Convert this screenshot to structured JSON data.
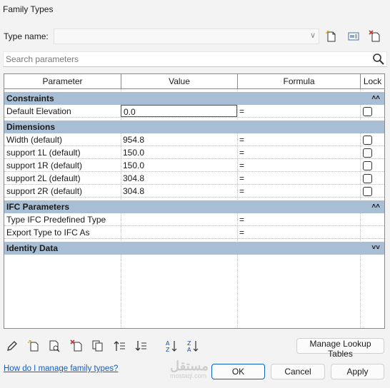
{
  "window": {
    "title": "Family Types"
  },
  "type_name": {
    "label": "Type name:",
    "value": ""
  },
  "search": {
    "placeholder": "Search parameters"
  },
  "columns": {
    "parameter": "Parameter",
    "value": "Value",
    "formula": "Formula",
    "lock": "Lock"
  },
  "groups": {
    "constraints": {
      "label": "Constraints",
      "rows": [
        {
          "parameter": "Default Elevation",
          "value": "0.0",
          "formula": "=",
          "locked": false
        }
      ]
    },
    "dimensions": {
      "label": "Dimensions",
      "rows": [
        {
          "parameter": "Width (default)",
          "value": "954.8",
          "formula": "=",
          "locked": false
        },
        {
          "parameter": "support 1L (default)",
          "value": "150.0",
          "formula": "=",
          "locked": false
        },
        {
          "parameter": "support 1R (default)",
          "value": "150.0",
          "formula": "=",
          "locked": false
        },
        {
          "parameter": "support 2L (default)",
          "value": "304.8",
          "formula": "=",
          "locked": false
        },
        {
          "parameter": "support 2R (default)",
          "value": "304.8",
          "formula": "=",
          "locked": false
        }
      ]
    },
    "ifc": {
      "label": "IFC Parameters",
      "rows": [
        {
          "parameter": "Type IFC Predefined Type",
          "value": "",
          "formula": "="
        },
        {
          "parameter": "Export Type to IFC As",
          "value": "",
          "formula": "="
        }
      ]
    },
    "identity": {
      "label": "Identity Data"
    }
  },
  "icons": {
    "toolbar": [
      "new-type-icon",
      "rename-type-icon",
      "delete-type-icon"
    ],
    "bottom": [
      "edit-parameter-icon",
      "new-parameter-icon",
      "shared-parameter-icon",
      "delete-parameter-icon",
      "copy-parameter-icon",
      "move-up-icon",
      "move-down-icon",
      "sort-ascending-icon",
      "sort-descending-icon"
    ]
  },
  "buttons": {
    "manage_lookup": "Manage Lookup Tables",
    "ok": "OK",
    "cancel": "Cancel",
    "apply": "Apply"
  },
  "help_link": "How do I manage family types?",
  "watermark": {
    "arabic": "مستقل",
    "latin": "mostaql.com"
  },
  "colors": {
    "group_header": "#a8bed4",
    "link": "#1a5cb8",
    "primary_border": "#0a63c4"
  }
}
